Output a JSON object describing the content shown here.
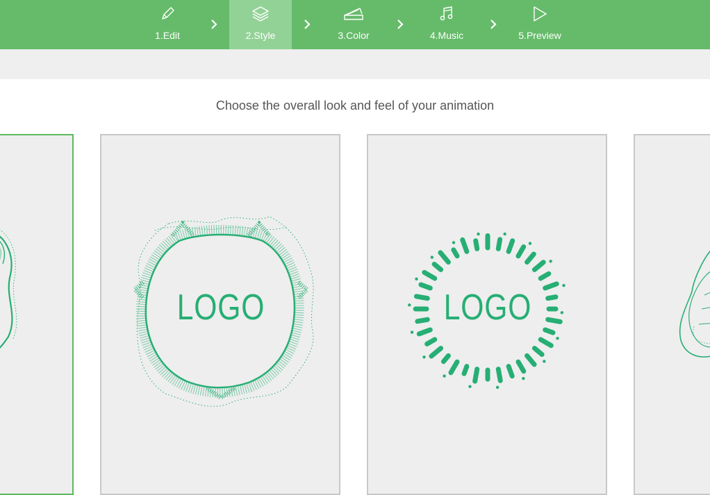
{
  "wizard": {
    "steps": [
      {
        "label": "1.Edit",
        "icon": "pencil-icon",
        "active": false
      },
      {
        "label": "2.Style",
        "icon": "layers-icon",
        "active": true
      },
      {
        "label": "3.Color",
        "icon": "swatch-icon",
        "active": false
      },
      {
        "label": "4.Music",
        "icon": "music-note-icon",
        "active": false
      },
      {
        "label": "5.Preview",
        "icon": "play-icon",
        "active": false
      }
    ],
    "separator_icon": "chevron-right-icon"
  },
  "main": {
    "instruction": "Choose the overall look and feel of your animation"
  },
  "styles": [
    {
      "id": "partial-left",
      "selected": true,
      "logo_text": ""
    },
    {
      "id": "wave-ring",
      "selected": false,
      "logo_text": "LOGO"
    },
    {
      "id": "dash-ring",
      "selected": false,
      "logo_text": "LOGO"
    },
    {
      "id": "partial-right",
      "selected": false,
      "logo_text": ""
    }
  ],
  "colors": {
    "brand": "#66bb6a",
    "active_step": "#93d296",
    "accent": "#27ae74",
    "card_bg": "#eeeeee"
  }
}
